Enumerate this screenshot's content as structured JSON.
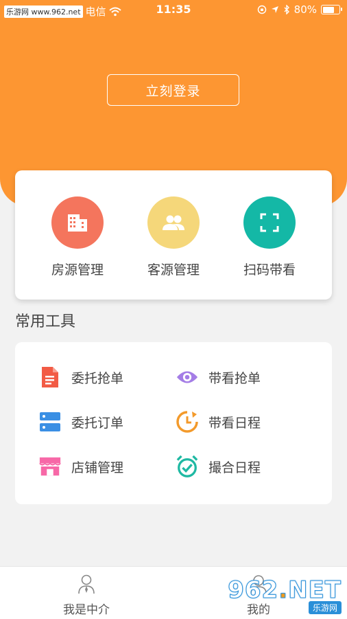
{
  "status_bar": {
    "watermark": "乐游网 www.962.net",
    "carrier": "电信",
    "time": "11:35",
    "battery_text": "80%",
    "battery_level": 0.8
  },
  "header": {
    "login_label": "立刻登录"
  },
  "quick_actions": [
    {
      "label": "房源管理",
      "icon": "building-icon",
      "color": "#f4755d"
    },
    {
      "label": "客源管理",
      "icon": "people-icon",
      "color": "#f5d77a"
    },
    {
      "label": "扫码带看",
      "icon": "scan-icon",
      "color": "#14b8a6"
    }
  ],
  "tools": {
    "title": "常用工具",
    "items": [
      {
        "label": "委托抢单",
        "icon": "document-icon",
        "color": "#f25b45"
      },
      {
        "label": "带看抢单",
        "icon": "eye-icon",
        "color": "#a47de6"
      },
      {
        "label": "委托订单",
        "icon": "server-list-icon",
        "color": "#3a8fe4"
      },
      {
        "label": "带看日程",
        "icon": "clock-refresh-icon",
        "color": "#f39a2b"
      },
      {
        "label": "店铺管理",
        "icon": "store-icon",
        "color": "#f768a7"
      },
      {
        "label": "撮合日程",
        "icon": "alarm-check-icon",
        "color": "#1fb9a3"
      }
    ]
  },
  "tabbar": {
    "tab1_label": "我是中介",
    "tab2_label": "我的"
  },
  "watermark": {
    "big_prefix": "962",
    "big_suffix": "NET",
    "small": "乐游网"
  }
}
